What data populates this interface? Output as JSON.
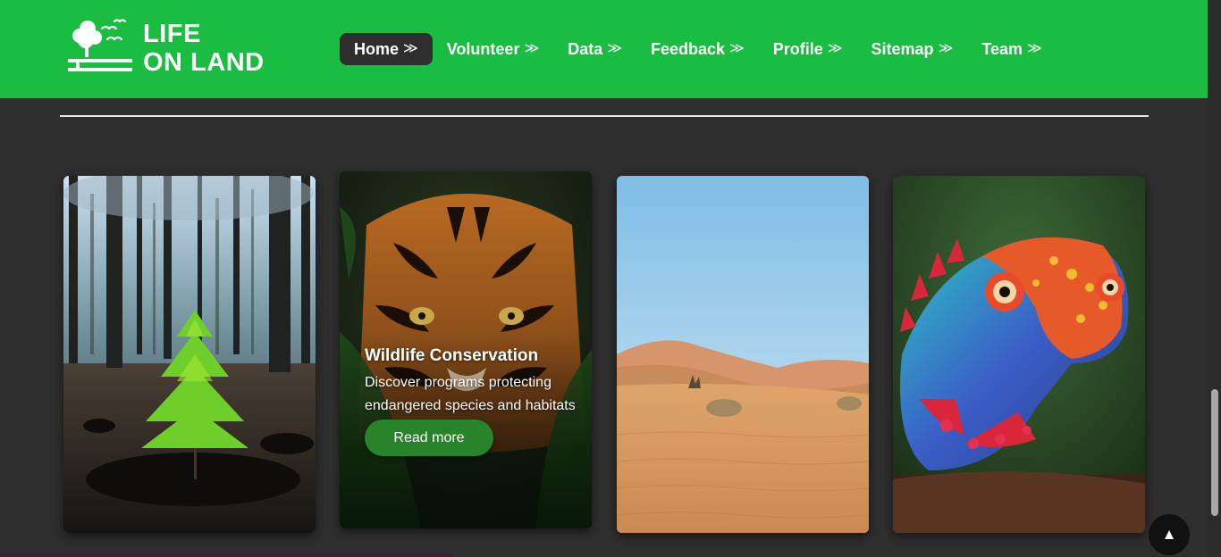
{
  "brand": {
    "line1": "LIFE",
    "line2": "ON LAND"
  },
  "nav": [
    {
      "label": "Home",
      "active": true
    },
    {
      "label": "Volunteer"
    },
    {
      "label": "Data"
    },
    {
      "label": "Feedback"
    },
    {
      "label": "Profile"
    },
    {
      "label": "Sitemap"
    },
    {
      "label": "Team"
    }
  ],
  "nav_chevron": "≫",
  "cards": [
    {
      "image": "forest-sapling"
    },
    {
      "image": "tiger",
      "title": "Wildlife Conservation",
      "description": "Discover programs protecting endangered species and habitats",
      "button": "Read more"
    },
    {
      "image": "desert-dunes"
    },
    {
      "image": "chameleon"
    }
  ],
  "back_to_top": "▲",
  "colors": {
    "nav_bg": "#1bbc42",
    "page_bg": "#2f2f2f",
    "button_bg": "#28842a"
  }
}
